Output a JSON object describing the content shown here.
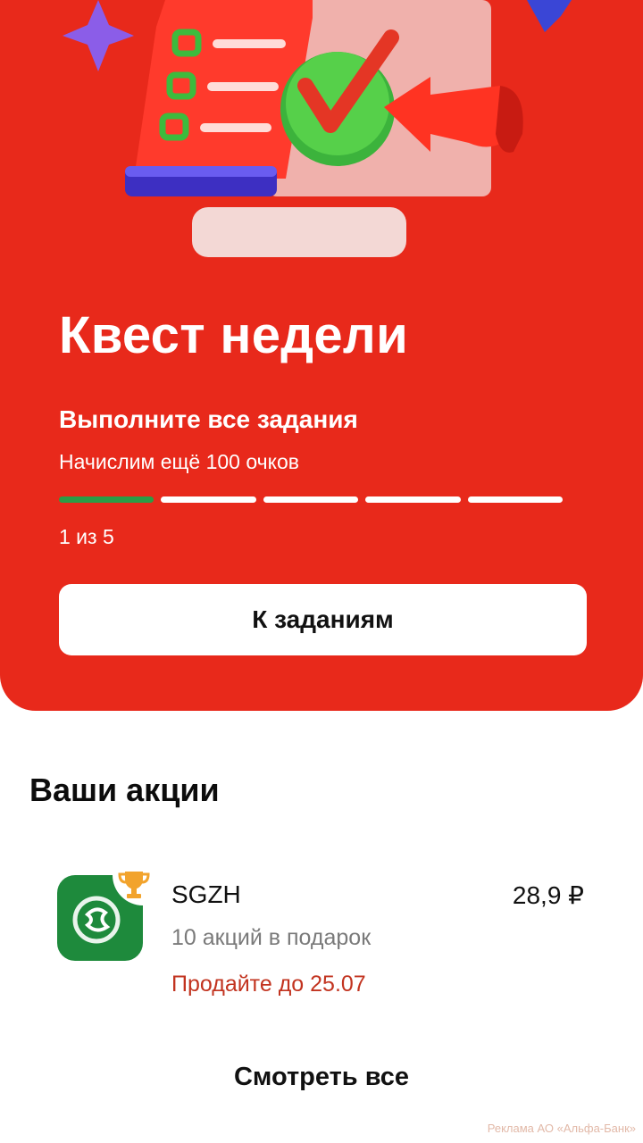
{
  "quest": {
    "title": "Квест недели",
    "subtitle": "Выполните все задания",
    "description": "Начислим ещё 100 очков",
    "progress_completed": 1,
    "progress_total": 5,
    "progress_text": "1 из 5",
    "button_label": "К заданиям",
    "colors": {
      "background": "#e8291b",
      "progress_done": "#2a9d46",
      "progress_todo": "#ffffff"
    }
  },
  "promotions": {
    "title": "Ваши акции",
    "items": [
      {
        "icon": "sgzh-logo-icon",
        "badge_icon": "trophy-icon",
        "name": "SGZH",
        "price": "28,9 ₽",
        "gift_text": "10 акций в подарок",
        "deadline_text": "Продайте до 25.07"
      }
    ],
    "see_all_label": "Смотреть все"
  },
  "footer": {
    "ad_note": "Реклама АО «Альфа-Банк»"
  }
}
